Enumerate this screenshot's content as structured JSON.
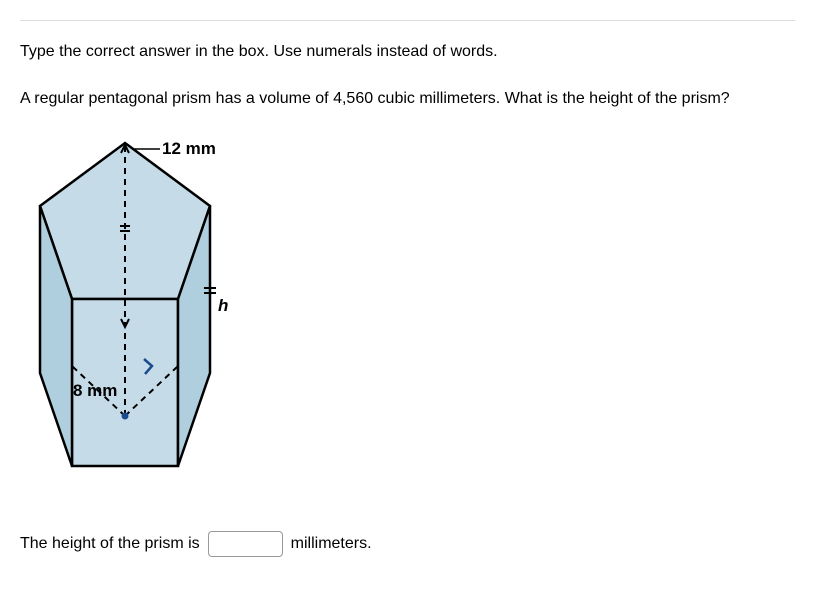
{
  "instruction": "Type the correct answer in the box. Use numerals instead of words.",
  "question": "A regular pentagonal prism has a volume of 4,560 cubic millimeters. What is the height of the prism?",
  "figure": {
    "label_top": "12 mm",
    "label_side": "h",
    "label_apothem": "8 mm"
  },
  "answer": {
    "prefix": "The height of the prism is",
    "value": "",
    "suffix": "millimeters."
  }
}
